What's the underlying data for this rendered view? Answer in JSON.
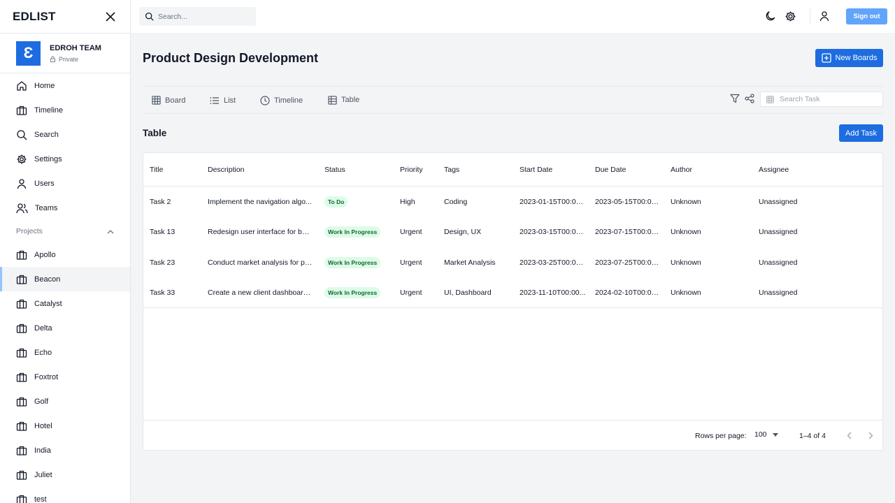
{
  "app": {
    "name": "EDLIST"
  },
  "team": {
    "logo_letter": "Ɛ",
    "name": "EDROH TEAM",
    "privacy": "Private"
  },
  "nav": {
    "items": [
      {
        "label": "Home",
        "icon": "home-icon"
      },
      {
        "label": "Timeline",
        "icon": "briefcase-icon"
      },
      {
        "label": "Search",
        "icon": "search-icon"
      },
      {
        "label": "Settings",
        "icon": "gear-icon"
      },
      {
        "label": "Users",
        "icon": "user-icon"
      },
      {
        "label": "Teams",
        "icon": "users-icon"
      }
    ]
  },
  "projects": {
    "header": "Projects",
    "items": [
      "Apollo",
      "Beacon",
      "Catalyst",
      "Delta",
      "Echo",
      "Foxtrot",
      "Golf",
      "Hotel",
      "India",
      "Juliet",
      "test"
    ],
    "active": "Beacon"
  },
  "topbar": {
    "search_placeholder": "Search...",
    "signout_label": "Sign out"
  },
  "page": {
    "title": "Product Design Development",
    "new_boards_label": "New Boards"
  },
  "tabs": [
    {
      "label": "Board",
      "icon": "grid-icon"
    },
    {
      "label": "List",
      "icon": "list-icon"
    },
    {
      "label": "Timeline",
      "icon": "clock-icon"
    },
    {
      "label": "Table",
      "icon": "table-icon",
      "active": true
    }
  ],
  "task_search_placeholder": "Search Task",
  "section": {
    "title": "Table",
    "add_task_label": "Add Task"
  },
  "table": {
    "columns": [
      "Title",
      "Description",
      "Status",
      "Priority",
      "Tags",
      "Start Date",
      "Due Date",
      "Author",
      "Assignee"
    ],
    "rows": [
      [
        "Task 2",
        "Implement the navigation algo...",
        "To Do",
        "High",
        "Coding",
        "2023-01-15T00:00...",
        "2023-05-15T00:00...",
        "Unknown",
        "Unassigned"
      ],
      [
        "Task 13",
        "Redesign user interface for bet...",
        "Work In Progress",
        "Urgent",
        "Design, UX",
        "2023-03-15T00:00...",
        "2023-07-15T00:00...",
        "Unknown",
        "Unassigned"
      ],
      [
        "Task 23",
        "Conduct market analysis for pr...",
        "Work In Progress",
        "Urgent",
        "Market Analysis",
        "2023-03-25T00:00...",
        "2023-07-25T00:00...",
        "Unknown",
        "Unassigned"
      ],
      [
        "Task 33",
        "Create a new client dashboard ...",
        "Work In Progress",
        "Urgent",
        "UI, Dashboard",
        "2023-11-10T00:00...",
        "2024-02-10T00:00...",
        "Unknown",
        "Unassigned"
      ]
    ]
  },
  "pagination": {
    "rows_per_page_label": "Rows per page:",
    "rows_per_page": "100",
    "range": "1–4 of 4"
  },
  "colors": {
    "primary": "#1d6ce0",
    "signout": "#60a5fa",
    "chip_bg": "#dcfce7",
    "chip_text": "#166534"
  }
}
